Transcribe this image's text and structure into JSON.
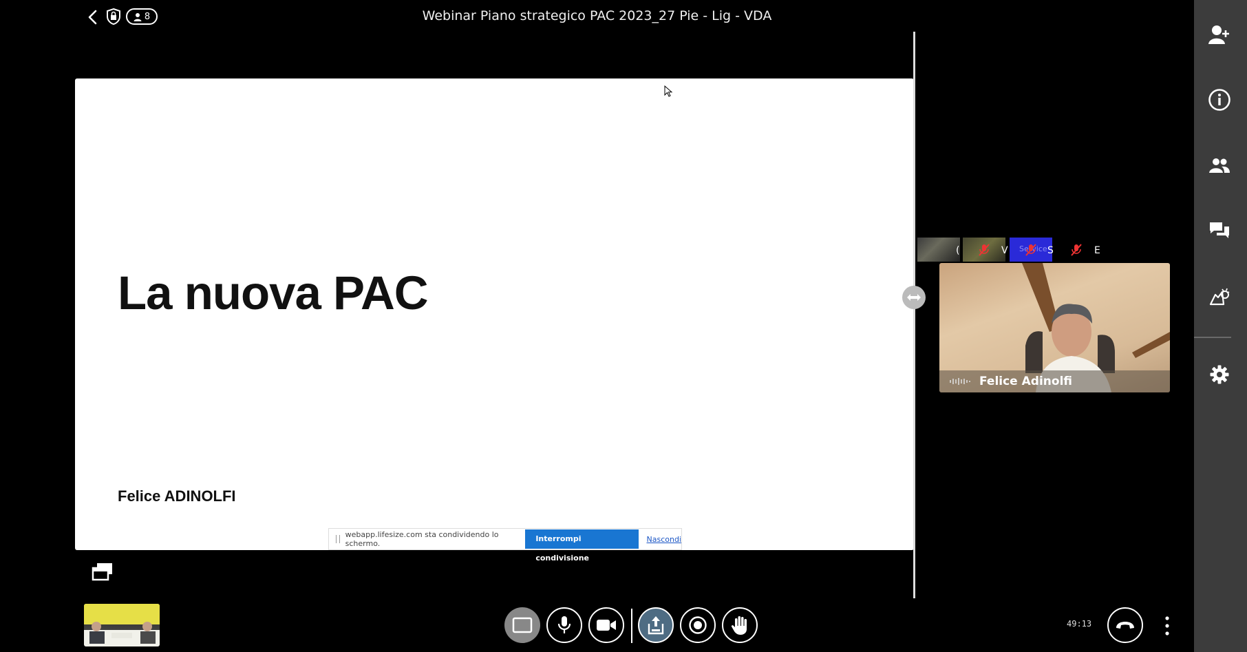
{
  "header": {
    "meeting_title": "Webinar Piano strategico PAC 2023_27 Pie - Lig - VDA",
    "participant_count": "8"
  },
  "slide": {
    "title": "La nuova PAC",
    "author": "Felice ADINOLFI"
  },
  "share_notice": {
    "message": "webapp.lifesize.com sta condividendo lo schermo.",
    "stop_label": "Interrompi condivisione",
    "hide_label": "Nascondi"
  },
  "participants_strip": [
    {
      "initial": "("
    },
    {
      "initial": "V"
    },
    {
      "initial": "S",
      "thumb_text": "Service"
    },
    {
      "initial": "E"
    }
  ],
  "active_speaker": {
    "name": "Felice Adinolfi"
  },
  "sidebar": {
    "items": [
      "add-participant-icon",
      "info-icon",
      "participants-icon",
      "chat-icon",
      "reactions-icon",
      "settings-icon"
    ]
  },
  "controls": {
    "timer": "49:13",
    "items": [
      "layout",
      "microphone",
      "camera",
      "share-screen",
      "record",
      "raise-hand"
    ]
  },
  "colors": {
    "share_button": "#1976d2",
    "sidebar_bg": "#3c3c3c",
    "active_control": "#4e6c83"
  }
}
